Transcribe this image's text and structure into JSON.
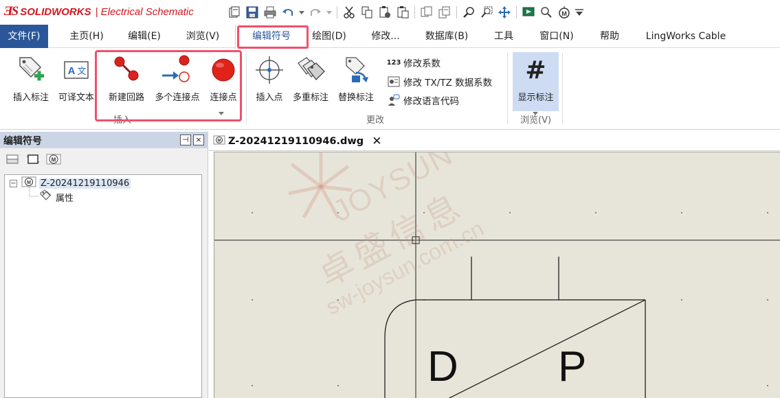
{
  "app": {
    "brand": "SOLIDWORKS",
    "product": "Electrical Schematic",
    "accent_color": "#2b579a",
    "logo_color": "#d2161e",
    "highlight_color": "#f0506a"
  },
  "quick_access": [
    "new-doc-icon",
    "save-icon",
    "print-icon",
    "undo-icon",
    "redo-icon",
    "cut-icon",
    "copy-icon",
    "paste-special-icon",
    "paste-icon",
    "copy-format-icon",
    "paste-format-icon",
    "zoom-icon",
    "zoom-window-icon",
    "pan-icon",
    "run-macro-icon",
    "search-icon",
    "symbol-m-icon",
    "dropdown-icon"
  ],
  "menu": {
    "file": "文件(F)",
    "tabs": [
      "主页(H)",
      "编辑(E)",
      "浏览(V)",
      "编辑符号",
      "绘图(D)",
      "修改...",
      "数据库(B)",
      "工具",
      "窗口(N)",
      "帮助",
      "LingWorks Cable"
    ],
    "active_tab": "编辑符号"
  },
  "ribbon": {
    "insert_tag": "插入标注",
    "translatable_text": "可译文本",
    "new_circuit": "新建回路",
    "multi_connection": "多个连接点",
    "connection_point": "连接点",
    "insert_point": "插入点",
    "multi_tag": "多重标注",
    "replace_tag": "替换标注",
    "modify_coefficient": "修改系数",
    "modify_txtz": "修改 TX/TZ 数据系数",
    "modify_language": "修改语言代码",
    "show_tag": "显示标注",
    "group_insert": "插入",
    "group_modify": "更改",
    "group_view": "浏览(V)",
    "coef_icon_text": "123",
    "show_icon_text": "#"
  },
  "left_panel": {
    "title": "编辑符号",
    "pin": "⊣",
    "close": "×",
    "tree_root": "Z-20241219110946",
    "tree_child": "属性",
    "expander": "−",
    "m_symbol": "M"
  },
  "document": {
    "tab_title": "Z-20241219110946.dwg",
    "close": "✕"
  },
  "canvas": {
    "letter_d": "D",
    "letter_p": "P",
    "watermark_brand": "JOYSUN",
    "watermark_cn": "卓盛信息",
    "watermark_url": "sw-joysun.com.cn"
  }
}
